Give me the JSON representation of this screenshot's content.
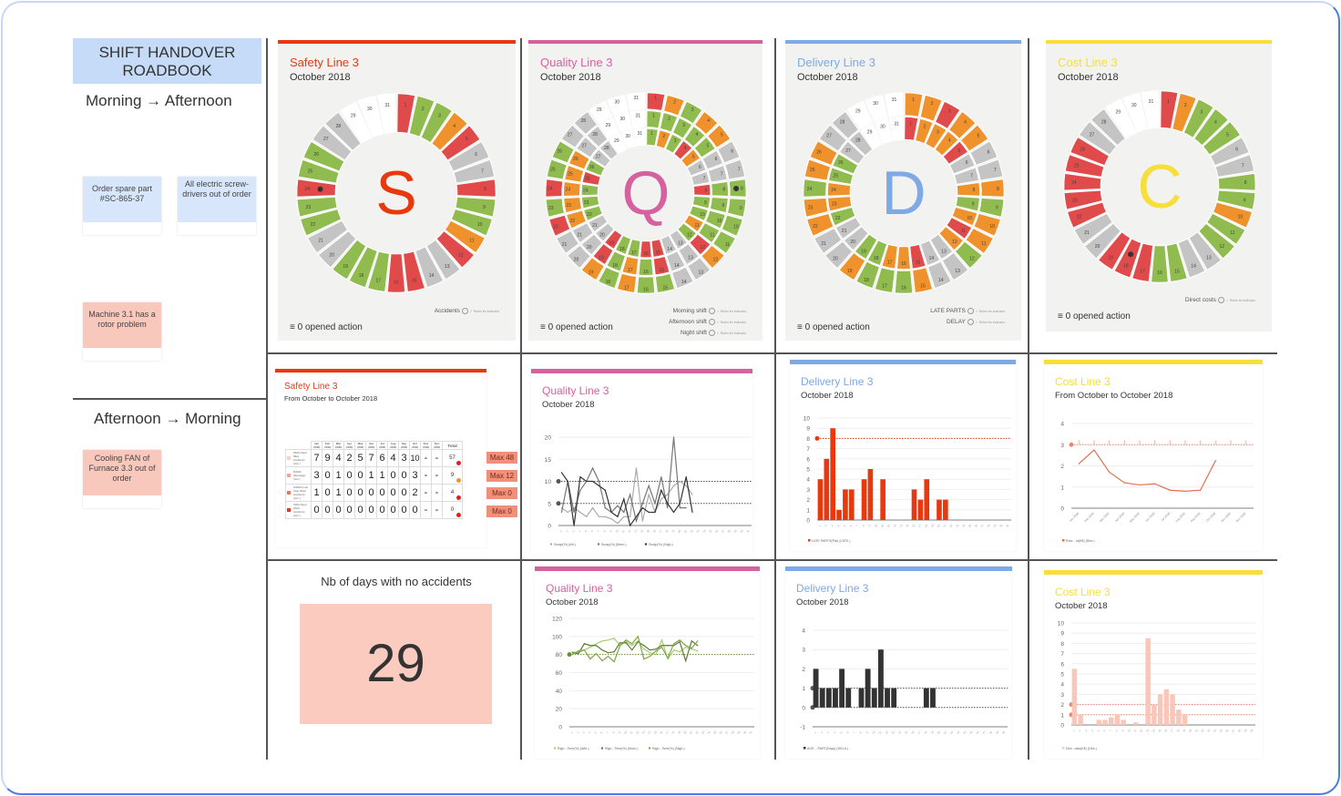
{
  "colors": {
    "safety": "#e8390e",
    "quality": "#d6619f",
    "delivery": "#7ea9e6",
    "cost": "#f7de3a",
    "ok": "#8fbb4f",
    "warn": "#f0922c",
    "bad": "#e04a4a",
    "off": "#c4c4c4",
    "empty": "#ffffff"
  },
  "roadbook": {
    "title": "SHIFT HANDOVER ROADBOOK",
    "section1": {
      "heading": "Morning → Afternoon",
      "notes": [
        {
          "text": "Order spare part #SC-865-37",
          "color": "blue"
        },
        {
          "text": "All electric screw-drivers out of order",
          "color": "blue"
        },
        {
          "text": "Machine 3.1 has a rotor problem",
          "color": "pink"
        }
      ]
    },
    "section2": {
      "heading": "Afternoon → Morning",
      "notes": [
        {
          "text": "Cooling FAN of Furnace 3.3 out of order",
          "color": "pink"
        }
      ]
    }
  },
  "calendars": [
    {
      "id": "safety",
      "title": "Safety Line 3",
      "subtitle": "October 2018",
      "letter": "S",
      "opened": "0 opened action",
      "legend": [
        "Accidents"
      ],
      "marker_day": 24,
      "rings": [
        [
          "bad",
          "ok",
          "ok",
          "warn",
          "bad",
          "off",
          "off",
          "bad",
          "ok",
          "ok",
          "warn",
          "bad",
          "off",
          "off",
          "bad",
          "bad",
          "ok",
          "ok",
          "ok",
          "off",
          "off",
          "ok",
          "ok",
          "bad",
          "ok",
          "ok",
          "off",
          "off",
          "empty",
          "empty",
          "empty"
        ]
      ]
    },
    {
      "id": "quality",
      "title": "Quality Line 3",
      "subtitle": "October 2018",
      "letter": "Q",
      "opened": "0 opened action",
      "legend": [
        "Morning shift",
        "Afternoon shift",
        "Night shift"
      ],
      "marker_day": 8,
      "rings": [
        [
          "bad",
          "warn",
          "ok",
          "warn",
          "warn",
          "off",
          "off",
          "ok",
          "ok",
          "ok",
          "ok",
          "warn",
          "off",
          "off",
          "ok",
          "ok",
          "warn",
          "ok",
          "warn",
          "off",
          "off",
          "bad",
          "ok",
          "bad",
          "ok",
          "ok",
          "off",
          "off",
          "empty",
          "empty",
          "empty"
        ],
        [
          "ok",
          "ok",
          "ok",
          "ok",
          "ok",
          "off",
          "off",
          "ok",
          "ok",
          "ok",
          "ok",
          "bad",
          "off",
          "off",
          "bad",
          "ok",
          "warn",
          "ok",
          "bad",
          "off",
          "off",
          "warn",
          "warn",
          "warn",
          "warn",
          "warn",
          "off",
          "off",
          "empty",
          "empty",
          "empty"
        ],
        [
          "ok",
          "warn",
          "ok",
          "bad",
          "warn",
          "off",
          "off",
          "bad",
          "ok",
          "ok",
          "warn",
          "ok",
          "off",
          "off",
          "bad",
          "bad",
          "ok",
          "ok",
          "bad",
          "off",
          "off",
          "ok",
          "ok",
          "ok",
          "bad",
          "ok",
          "off",
          "off",
          "empty",
          "empty",
          "empty"
        ]
      ]
    },
    {
      "id": "delivery",
      "title": "Delivery Line 3",
      "subtitle": "October 2018",
      "letter": "D",
      "opened": "0 opened action",
      "legend": [
        "LATE PARTS",
        "DELAY"
      ],
      "marker_day": null,
      "rings": [
        [
          "warn",
          "warn",
          "bad",
          "warn",
          "warn",
          "off",
          "off",
          "warn",
          "ok",
          "warn",
          "warn",
          "ok",
          "off",
          "off",
          "warn",
          "ok",
          "ok",
          "ok",
          "warn",
          "off",
          "off",
          "warn",
          "warn",
          "ok",
          "warn",
          "warn",
          "off",
          "off",
          "empty",
          "empty",
          "empty"
        ],
        [
          "bad",
          "warn",
          "warn",
          "warn",
          "bad",
          "off",
          "off",
          "warn",
          "ok",
          "warn",
          "bad",
          "warn",
          "off",
          "off",
          "bad",
          "warn",
          "warn",
          "ok",
          "ok",
          "off",
          "off",
          "ok",
          "warn",
          "warn",
          "ok",
          "ok",
          "off",
          "off",
          "empty",
          "empty",
          "empty"
        ]
      ]
    },
    {
      "id": "cost",
      "title": "Cost Line 3",
      "subtitle": "October 2018",
      "letter": "C",
      "opened": "0 opened action",
      "legend": [
        "Direct costs"
      ],
      "marker_day": 18,
      "rings": [
        [
          "bad",
          "warn",
          "ok",
          "ok",
          "ok",
          "off",
          "off",
          "ok",
          "ok",
          "warn",
          "ok",
          "ok",
          "off",
          "off",
          "ok",
          "ok",
          "bad",
          "bad",
          "bad",
          "off",
          "off",
          "bad",
          "bad",
          "bad",
          "bad",
          "bad",
          "off",
          "off",
          "empty",
          "empty",
          "empty"
        ]
      ]
    }
  ],
  "safety_table": {
    "title": "Safety Line 3",
    "subtitle": "From October to October 2018",
    "months": [
      "Jan 2018",
      "Feb 2018",
      "Mar 2018",
      "Apr 2018",
      "May 2018",
      "Jun 2018",
      "Jul 2018",
      "Aug 2018",
      "Sep 2018",
      "Oct 2018",
      "Nov 2018",
      "Dec 2018"
    ],
    "total_label": "Total",
    "rows": [
      {
        "label": "NMA (Near Miss Accident) (Acc.)",
        "values": [
          "7",
          "9",
          "4",
          "2",
          "5",
          "7",
          "6",
          "4",
          "3",
          "10",
          "-",
          "-"
        ],
        "total": "57",
        "dot": "#e02020",
        "max": "Max 48",
        "swatch": "#f8d0c8"
      },
      {
        "label": "DAMA (Damage) (Acc.)",
        "values": [
          "3",
          "0",
          "1",
          "0",
          "0",
          "1",
          "1",
          "0",
          "0",
          "3",
          "-",
          "-"
        ],
        "total": "9",
        "dot": "#f0952c",
        "max": "Max 12",
        "swatch": "#f2a595"
      },
      {
        "label": "ASWA (Lost Stop Work Accident) (Acc.)",
        "values": [
          "1",
          "0",
          "1",
          "0",
          "0",
          "0",
          "0",
          "0",
          "0",
          "2",
          "-",
          "-"
        ],
        "total": "4",
        "dot": "#e02020",
        "max": "Max 0",
        "swatch": "#ec7560"
      },
      {
        "label": "SWA (Stop Work Accident) (Acc.)",
        "values": [
          "0",
          "0",
          "0",
          "0",
          "0",
          "0",
          "0",
          "0",
          "0",
          "0",
          "-",
          "-"
        ],
        "total": "0",
        "dot": "#e02020",
        "max": "Max 0",
        "swatch": "#e03a20"
      }
    ]
  },
  "no_accidents": {
    "label": "Nb of days with no accidents",
    "value": "29"
  },
  "chart_data": [
    {
      "id": "quality-scrap",
      "type": "line",
      "title": "Quality Line 3",
      "subtitle": "October 2018",
      "ylim": [
        0,
        20
      ],
      "yticks": [
        0,
        5,
        10,
        15,
        20
      ],
      "x": [
        1,
        2,
        3,
        4,
        5,
        6,
        7,
        8,
        9,
        10,
        11,
        12,
        13,
        14,
        15,
        16,
        17,
        18,
        19,
        20,
        21,
        22,
        23,
        24,
        25,
        26
      ],
      "targets": [
        10,
        5
      ],
      "series": [
        {
          "name": "Scrap(%) (Aft.)",
          "color": "#aaaaaa",
          "values": [
            4,
            3,
            4,
            3,
            2,
            4,
            2,
            2,
            1.5,
            0.5,
            2,
            2,
            13,
            1,
            7,
            3,
            6,
            7,
            9,
            10,
            9,
            7
          ]
        },
        {
          "name": "Scrap(%) (Morn.)",
          "color": "#777777",
          "values": [
            3,
            10,
            3,
            8,
            10,
            13,
            10,
            4,
            3,
            4.5,
            3,
            7,
            1,
            5,
            9,
            5,
            11,
            4,
            20,
            4,
            4,
            null
          ]
        },
        {
          "name": "Scrap(%) (Nigh.)",
          "color": "#333333",
          "values": [
            12,
            10,
            0,
            11,
            10,
            10,
            9,
            8,
            3,
            2,
            6,
            0,
            2,
            4,
            3,
            3,
            8,
            5,
            3,
            5,
            11,
            3
          ]
        }
      ]
    },
    {
      "id": "delivery-late-parts",
      "type": "bar",
      "title": "Delivery Line 3",
      "subtitle": "October 2018",
      "ylim": [
        0,
        10
      ],
      "yticks": [
        0,
        1,
        2,
        3,
        4,
        5,
        6,
        7,
        8,
        9,
        10
      ],
      "target": 8,
      "color": "#e8390e",
      "legend": "LATE PARTS(Par) (LATE.)",
      "values": [
        4,
        6,
        9,
        1,
        3,
        3,
        0,
        4,
        5,
        0,
        4,
        0,
        0,
        0,
        0,
        3,
        2,
        4,
        0,
        2,
        2,
        0,
        0,
        0,
        0
      ]
    },
    {
      "id": "cost-monthly",
      "type": "line",
      "title": "Cost Line 3",
      "subtitle": "From October to October 2018",
      "ylim": [
        0,
        4
      ],
      "yticks": [
        0,
        1,
        2,
        3,
        4
      ],
      "categories": [
        "Jan 2018",
        "Feb 2018",
        "Mar 2018",
        "Apr 2018",
        "May 2018",
        "Jun 2018",
        "Jul 2018",
        "Aug 2018",
        "Sep 2018",
        "Oct 2018",
        "Nov 2018",
        "Dec 2018"
      ],
      "target": 3,
      "color": "#e2704e",
      "legend": "Rew... st(K€) (Dire.)",
      "values": [
        2.1,
        2.75,
        1.7,
        1.2,
        1.1,
        1.15,
        0.85,
        0.8,
        0.85,
        2.25,
        null,
        null
      ]
    },
    {
      "id": "quality-right-first-time",
      "type": "line",
      "title": "Quality Line 3",
      "subtitle": "October 2018",
      "ylim": [
        0,
        120
      ],
      "yticks": [
        0,
        20,
        40,
        60,
        80,
        100,
        120
      ],
      "target": 80,
      "series": [
        {
          "name": "Righ...Time(%) (Afte.)",
          "color": "#a6cf6e",
          "values": [
            83,
            82,
            85,
            88,
            92,
            95,
            96,
            98,
            90,
            94,
            90,
            95,
            86,
            82,
            80,
            96,
            75,
            85,
            83,
            88,
            86,
            84
          ]
        },
        {
          "name": "Righ...Time(%) (Morn.)",
          "color": "#5e7a3a",
          "values": [
            82,
            81,
            92,
            90,
            90,
            85,
            82,
            83,
            93,
            93,
            85,
            94,
            90,
            85,
            86,
            90,
            90,
            90,
            94,
            73,
            95,
            90
          ]
        },
        {
          "name": "Righ...Time(%) (Nigh.)",
          "color": "#7fa646",
          "values": [
            80,
            84,
            85,
            75,
            81,
            73,
            78,
            72,
            90,
            96,
            92,
            100,
            75,
            78,
            84,
            88,
            76,
            92,
            96,
            90,
            87,
            95
          ]
        }
      ]
    },
    {
      "id": "delivery-delay",
      "type": "bar",
      "title": "Delivery Line 3",
      "subtitle": "October 2018",
      "ylim": [
        -1,
        4
      ],
      "yticks": [
        -1,
        0,
        1,
        2,
        3,
        4
      ],
      "targets": [
        1,
        0
      ],
      "color": "#333333",
      "legend": "AGE ...PART(Days) (DELA.)",
      "values": [
        2,
        1,
        1,
        1,
        2,
        1,
        0,
        1,
        2,
        1,
        3,
        1,
        1,
        0,
        0,
        0,
        0,
        1,
        1,
        0,
        0,
        0,
        0,
        0
      ]
    },
    {
      "id": "cost-direct",
      "type": "bar",
      "title": "Cost Line 3",
      "subtitle": "October 2018",
      "ylim": [
        0,
        10
      ],
      "yticks": [
        0,
        1,
        2,
        3,
        4,
        5,
        6,
        7,
        8,
        9,
        10
      ],
      "targets": [
        2,
        1
      ],
      "color": "#f9c6ba",
      "legend": "Dire...osts(K€) (Dire.)",
      "values": [
        5.5,
        1,
        0,
        0,
        0.5,
        0.5,
        0.75,
        1,
        0.5,
        0,
        0.25,
        0,
        8.5,
        2,
        3,
        3.5,
        3,
        1.5,
        1,
        0,
        0,
        0,
        0,
        0
      ]
    }
  ]
}
